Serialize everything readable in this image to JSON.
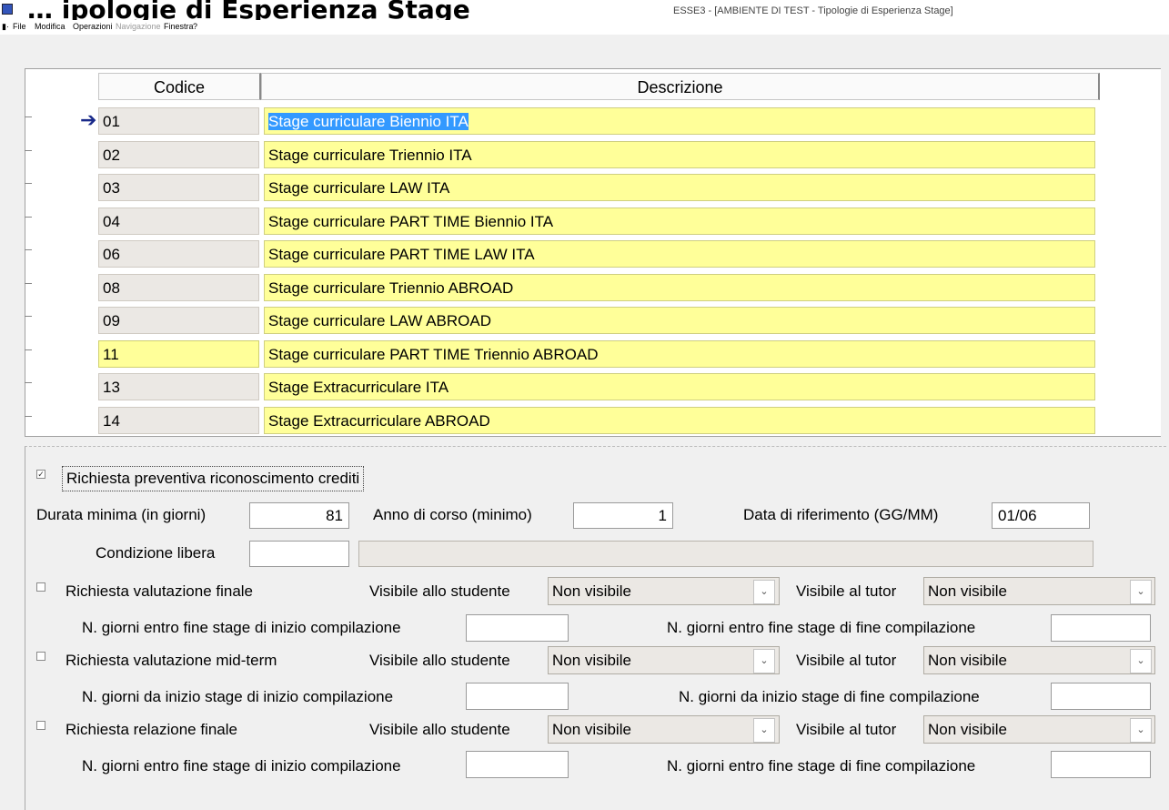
{
  "window": {
    "title": "ESSE3 - [AMBIENTE DI TEST - Tipologie di Esperienza Stage]",
    "top_text": "… ipologie di Esperienza Stage"
  },
  "menu": {
    "file": "File",
    "modifica": "Modifica",
    "operazioni": "Operazioni",
    "navigazione": "Navigazione",
    "finestra": "Finestra",
    "help": "?"
  },
  "grid": {
    "headers": {
      "code": "Codice",
      "description": "Descrizione"
    },
    "rows": [
      {
        "code": "01",
        "description": "Stage curriculare Biennio ITA"
      },
      {
        "code": "02",
        "description": "Stage curriculare Triennio ITA"
      },
      {
        "code": "03",
        "description": "Stage curriculare LAW ITA"
      },
      {
        "code": "04",
        "description": "Stage curriculare PART TIME Biennio ITA"
      },
      {
        "code": "06",
        "description": "Stage curriculare PART TIME LAW ITA"
      },
      {
        "code": "08",
        "description": "Stage curriculare Triennio ABROAD"
      },
      {
        "code": "09",
        "description": "Stage curriculare LAW ABROAD"
      },
      {
        "code": "11",
        "description": "Stage curriculare PART TIME Triennio ABROAD"
      },
      {
        "code": "13",
        "description": "Stage Extracurriculare ITA"
      },
      {
        "code": "14",
        "description": "Stage Extracurriculare ABROAD"
      }
    ],
    "current_row_icon": "right-arrow-icon"
  },
  "form": {
    "richiesta_preventiva": {
      "label": "Richiesta preventiva riconoscimento crediti",
      "checked": true,
      "mark": "✓"
    },
    "durata_minima": {
      "label": "Durata minima (in giorni)",
      "value": "81"
    },
    "anno_corso": {
      "label": "Anno di corso (minimo)",
      "value": "1"
    },
    "data_riferimento": {
      "label": "Data di riferimento (GG/MM)",
      "value": "01/06"
    },
    "condizione_libera": {
      "label": "Condizione libera",
      "value": "",
      "extra": ""
    },
    "valutazione_finale": {
      "label": "Richiesta valutazione finale",
      "visibile_studente_label": "Visibile allo studente",
      "visibile_studente_value": "Non visibile",
      "visibile_tutor_label": "Visibile al tutor",
      "visibile_tutor_value": "Non visibile",
      "inizio_label": "N. giorni entro fine stage di inizio compilazione",
      "inizio_value": "",
      "fine_label": "N. giorni entro fine stage di fine compilazione",
      "fine_value": ""
    },
    "valutazione_midterm": {
      "label": "Richiesta valutazione mid-term",
      "visibile_studente_label": "Visibile allo studente",
      "visibile_studente_value": "Non visibile",
      "visibile_tutor_label": "Visibile al tutor",
      "visibile_tutor_value": "Non visibile",
      "inizio_label": "N. giorni da inizio stage di inizio compilazione",
      "inizio_value": "",
      "fine_label": "N. giorni da inizio stage di fine compilazione",
      "fine_value": ""
    },
    "relazione_finale": {
      "label": "Richiesta relazione finale",
      "visibile_studente_label": "Visibile allo studente",
      "visibile_studente_value": "Non visibile",
      "visibile_tutor_label": "Visibile al tutor",
      "visibile_tutor_value": "Non visibile",
      "inizio_label": "N. giorni entro fine stage di inizio compilazione",
      "inizio_value": "",
      "fine_label": "N. giorni entro fine stage di fine compilazione",
      "fine_value": ""
    }
  },
  "colors": {
    "row_yellow": "#ffff99",
    "code_gray": "#ebe8e4",
    "selection": "#3399ff",
    "arrow": "#1a2a8a"
  }
}
